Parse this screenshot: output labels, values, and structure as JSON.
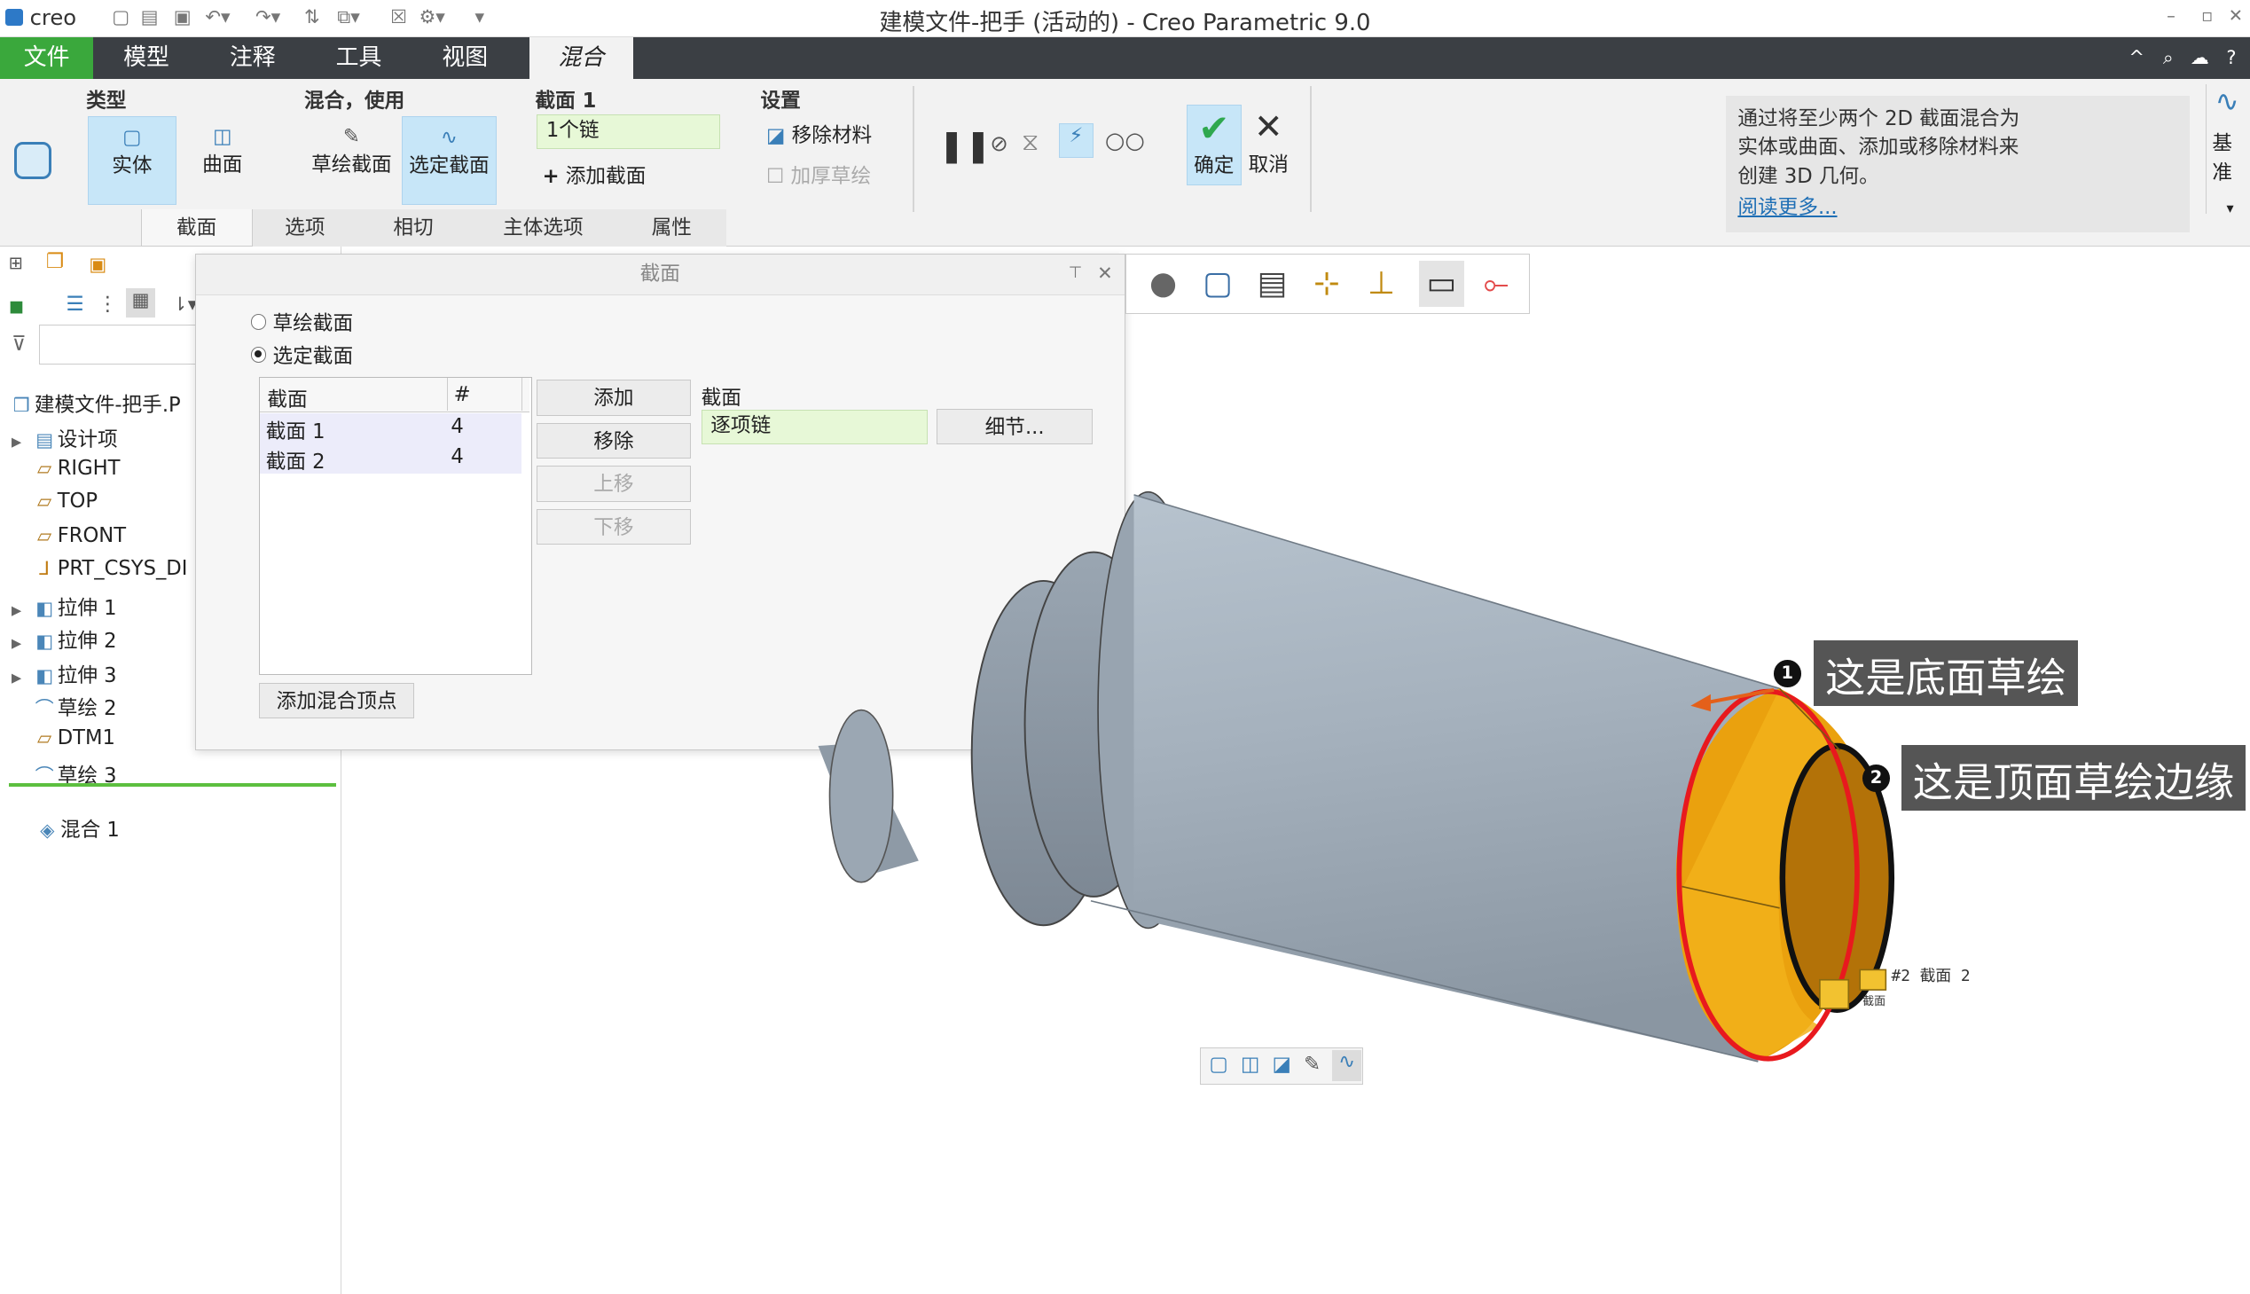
{
  "titlebar": {
    "logo": "creo",
    "title": "建模文件-把手 (活动的) - Creo Parametric 9.0",
    "window_controls": [
      "–",
      "▫",
      "✕"
    ]
  },
  "menubar": {
    "tabs": [
      "文件",
      "模型",
      "注释",
      "工具",
      "视图",
      "混合"
    ],
    "right_icons": [
      "^",
      "⌕",
      "☁",
      "?"
    ]
  },
  "ribbon": {
    "type_group": {
      "label": "类型",
      "solid": "实体",
      "surface": "曲面"
    },
    "blend_group": {
      "label": "混合，使用",
      "sketch": "草绘截面",
      "selected": "选定截面"
    },
    "section_group": {
      "label": "截面 1",
      "chain_value": "1个链",
      "add_section": "添加截面"
    },
    "settings_group": {
      "label": "设置",
      "remove_material": "移除材料",
      "thicken": "加厚草绘"
    },
    "ok": "确定",
    "cancel": "取消",
    "datum": "基准",
    "subtabs": [
      "截面",
      "选项",
      "相切",
      "主体选项",
      "属性"
    ]
  },
  "info_panel": {
    "text_lines": [
      "通过将至少两个 2D 截面混合为",
      "实体或曲面、添加或移除材料来",
      "创建 3D 几何。"
    ],
    "link": "阅读更多..."
  },
  "model_tree": {
    "items": [
      {
        "label": "建模文件-把手.P",
        "icon": "part-icon"
      },
      {
        "label": "设计项",
        "icon": "design-items-icon"
      },
      {
        "label": "RIGHT",
        "icon": "datum-plane-icon"
      },
      {
        "label": "TOP",
        "icon": "datum-plane-icon"
      },
      {
        "label": "FRONT",
        "icon": "datum-plane-icon"
      },
      {
        "label": "PRT_CSYS_DI",
        "icon": "csys-icon"
      },
      {
        "label": "拉伸 1",
        "icon": "extrude-icon"
      },
      {
        "label": "拉伸 2",
        "icon": "extrude-icon"
      },
      {
        "label": "拉伸 3",
        "icon": "extrude-icon"
      },
      {
        "label": "草绘 2",
        "icon": "sketch-icon"
      },
      {
        "label": "DTM1",
        "icon": "datum-plane-icon"
      },
      {
        "label": "草绘 3",
        "icon": "sketch-icon"
      },
      {
        "label": "混合 1",
        "icon": "blend-icon"
      }
    ]
  },
  "dialog": {
    "title": "截面",
    "radio_sketch": "草绘截面",
    "radio_selected": "选定截面",
    "table_headers": [
      "截面",
      "#"
    ],
    "rows": [
      {
        "name": "截面 1",
        "count": "4"
      },
      {
        "name": "截面 2",
        "count": "4"
      }
    ],
    "buttons": {
      "add": "添加",
      "remove": "移除",
      "move_up": "上移",
      "move_down": "下移"
    },
    "section_label": "截面",
    "section_value": "逐项链",
    "details": "细节...",
    "add_vertex": "添加混合顶点"
  },
  "callouts": [
    {
      "num": "1",
      "text": "这是底面草绘"
    },
    {
      "num": "2",
      "text": "这是顶面草绘边缘"
    }
  ],
  "model_labels": {
    "section2": "#2  截面  2",
    "small_label": "截面"
  },
  "colors": {
    "menubar": "#3b3f44",
    "file_tab": "#3aa83c",
    "accent_red": "#e8191e",
    "face_orange": "#e99a10",
    "body": "#a8b3be"
  }
}
